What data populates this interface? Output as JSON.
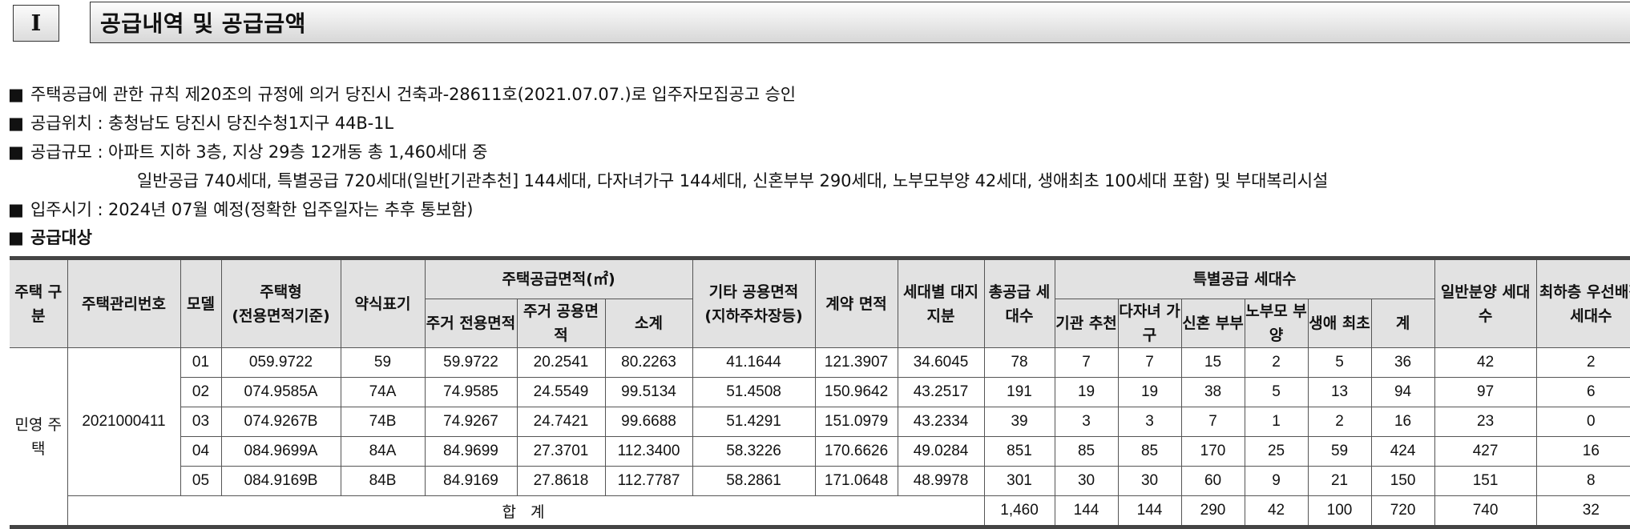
{
  "section": {
    "number": "I",
    "title": "공급내역 및 공급금액"
  },
  "bullets": {
    "marker": "■",
    "approval": "주택공급에 관한 규칙 제20조의 규정에 의거 당진시 건축과-28611호(2021.07.07.)로 입주자모집공고 승인",
    "location": "공급위치 : 충청남도 당진시 당진수청1지구 44B-1L",
    "scale_line1": "공급규모 : 아파트 지하 3층, 지상 29층 12개동 총 1,460세대 중",
    "scale_line2": "일반공급 740세대, 특별공급 720세대(일반[기관추천] 144세대, 다자녀가구 144세대, 신혼부부 290세대, 노부모부양 42세대, 생애최초 100세대 포함) 및 부대복리시설",
    "move_in": "입주시기 : 2024년 07월 예정(정확한 입주일자는 추후 통보함)",
    "target": "공급대상"
  },
  "table": {
    "headers": {
      "house_type_group": "주택 구분",
      "mgmt_no": "주택관리번호",
      "model": "모델",
      "house_type": "주택형",
      "house_type_sub": "(전용면적기준)",
      "short": "약식표기",
      "supply_area": "주택공급면적(㎡)",
      "exclusive": "주거 전용면적",
      "common": "주거 공용면적",
      "subtotal": "소계",
      "other_common": "기타 공용면적",
      "other_common_sub": "(지하주차장등)",
      "contract_area": "계약 면적",
      "land_share": "세대별 대지지분",
      "total_supply": "총공급 세대수",
      "special_group": "특별공급 세대수",
      "inst": "기관 추천",
      "multi_child": "다자녀 가구",
      "newlywed": "신혼 부부",
      "parents": "노부모 부양",
      "first_time": "생애 최초",
      "special_sum": "계",
      "general": "일반분양 세대수",
      "lowest_floor": "최하층 우선배정 세대수"
    },
    "group_label": "민영 주택",
    "mgmt_number": "2021000411",
    "rows": [
      {
        "model": "01",
        "type": "059.9722",
        "short": "59",
        "excl": "59.9722",
        "comm": "20.2541",
        "sub": "80.2263",
        "other": "41.1644",
        "contract": "121.3907",
        "land": "34.6045",
        "total": "78",
        "inst": "7",
        "multi": "7",
        "newly": "15",
        "parents": "2",
        "first": "5",
        "sum": "36",
        "general": "42",
        "lowest": "2"
      },
      {
        "model": "02",
        "type": "074.9585A",
        "short": "74A",
        "excl": "74.9585",
        "comm": "24.5549",
        "sub": "99.5134",
        "other": "51.4508",
        "contract": "150.9642",
        "land": "43.2517",
        "total": "191",
        "inst": "19",
        "multi": "19",
        "newly": "38",
        "parents": "5",
        "first": "13",
        "sum": "94",
        "general": "97",
        "lowest": "6"
      },
      {
        "model": "03",
        "type": "074.9267B",
        "short": "74B",
        "excl": "74.9267",
        "comm": "24.7421",
        "sub": "99.6688",
        "other": "51.4291",
        "contract": "151.0979",
        "land": "43.2334",
        "total": "39",
        "inst": "3",
        "multi": "3",
        "newly": "7",
        "parents": "1",
        "first": "2",
        "sum": "16",
        "general": "23",
        "lowest": "0"
      },
      {
        "model": "04",
        "type": "084.9699A",
        "short": "84A",
        "excl": "84.9699",
        "comm": "27.3701",
        "sub": "112.3400",
        "other": "58.3226",
        "contract": "170.6626",
        "land": "49.0284",
        "total": "851",
        "inst": "85",
        "multi": "85",
        "newly": "170",
        "parents": "25",
        "first": "59",
        "sum": "424",
        "general": "427",
        "lowest": "16"
      },
      {
        "model": "05",
        "type": "084.9169B",
        "short": "84B",
        "excl": "84.9169",
        "comm": "27.8618",
        "sub": "112.7787",
        "other": "58.2861",
        "contract": "171.0648",
        "land": "48.9978",
        "total": "301",
        "inst": "30",
        "multi": "30",
        "newly": "60",
        "parents": "9",
        "first": "21",
        "sum": "150",
        "general": "151",
        "lowest": "8"
      }
    ],
    "total_row": {
      "label": "합 계",
      "total": "1,460",
      "inst": "144",
      "multi": "144",
      "newly": "290",
      "parents": "42",
      "first": "100",
      "sum": "720",
      "general": "740",
      "lowest": "32"
    }
  }
}
